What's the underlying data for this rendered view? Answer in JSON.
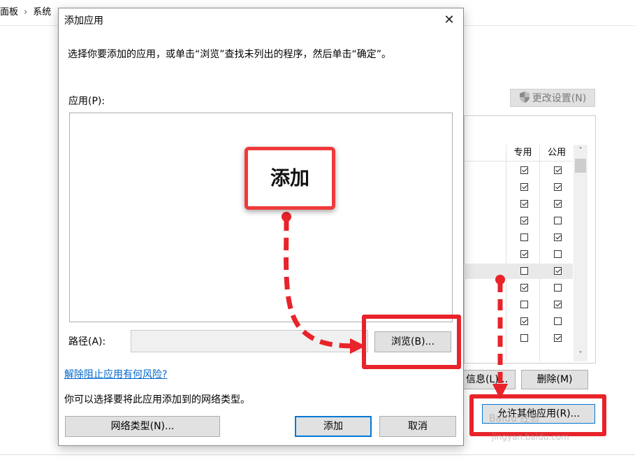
{
  "breadcrumb": {
    "item1": "面板",
    "item2": "系统"
  },
  "background_window": {
    "change_settings_label": "更改设置(N)",
    "columns": {
      "private": "专用",
      "public": "公用"
    },
    "rows": [
      {
        "private": true,
        "public": true
      },
      {
        "private": true,
        "public": true
      },
      {
        "private": true,
        "public": true
      },
      {
        "private": true,
        "public": false
      },
      {
        "private": false,
        "public": true
      },
      {
        "private": true,
        "public": false
      },
      {
        "private": false,
        "public": true
      },
      {
        "private": true,
        "public": false
      },
      {
        "private": false,
        "public": true
      },
      {
        "private": true,
        "public": false
      },
      {
        "private": false,
        "public": true
      }
    ],
    "details_button_label": "信息(L)...",
    "delete_button_label": "删除(M)",
    "allow_other_button_label": "允许其他应用(R)..."
  },
  "dialog": {
    "title": "添加应用",
    "instruction": "选择你要添加的应用，或单击“浏览”查找未列出的程序，然后单击“确定”。",
    "apps_label": "应用(P):",
    "path_label": "路径(A):",
    "path_value": "",
    "browse_label": "浏览(B)...",
    "risk_link": "解除阻止应用有何风险?",
    "network_text": "你可以选择要将此应用添加到的网络类型。",
    "network_type_label": "网络类型(N)...",
    "add_label": "添加",
    "cancel_label": "取消"
  },
  "annotation": {
    "callout_text": "添加",
    "accent_color": "#e8232a"
  },
  "watermark": {
    "line1": "Baidu 经验",
    "line2": "jingyan.baidu.com"
  }
}
